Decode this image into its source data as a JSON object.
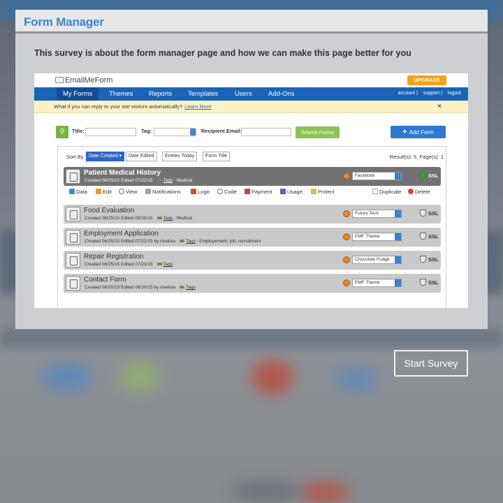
{
  "modal": {
    "title": "Form Manager",
    "description": "This survey is about the form manager page and how we can make this page better for you"
  },
  "start_survey_label": "Start Survey",
  "app": {
    "logo": "EmailMeForm",
    "upgrade": "UPGRADE",
    "nav": [
      "My Forms",
      "Themes",
      "Reports",
      "Templates",
      "Users",
      "Add-Ons"
    ],
    "nav_right": [
      "account",
      "support",
      "logout"
    ],
    "notice_text": "What if you can reply to your site visitors automatically?",
    "notice_link": "Learn More",
    "close": "×",
    "search": {
      "title_label": "Title:",
      "tag_label": "Tag:",
      "recipient_label": "Recipient Email:",
      "button": "Search Forms"
    },
    "add_form": "Add Form",
    "sort_label": "Sort By",
    "sort_options": [
      "Date Created",
      "Date Edited",
      "Entries Today",
      "Form Title"
    ],
    "result": "Result(s): 5, Page(s): 1",
    "actions": [
      "Data",
      "Edit",
      "View",
      "Notifications",
      "Logic",
      "Code",
      "Payment",
      "Usage",
      "Protect",
      "Duplicate",
      "Delete"
    ],
    "forms": [
      {
        "title": "Patient Medical History",
        "meta": "Created 06/25/15   Edited 07/22/15",
        "tags_label": "Tags",
        "tags": ": Medical",
        "theme": "Facebook",
        "ssl": "SSL"
      },
      {
        "title": "Food Evaluation",
        "meta": "Created 06/25/15   Edited 06/25/15",
        "tags_label": "Tags",
        "tags": ": Medical",
        "theme": "Future Tech",
        "ssl": "SSL"
      },
      {
        "title": "Employment Application",
        "meta": "Created 06/25/15   Edited 07/22/15 by niveluia",
        "tags_label": "Tags",
        "tags": ": Employement, job, recruitment",
        "theme": "EMF Theme",
        "ssl": "SSL"
      },
      {
        "title": "Repair Registration",
        "meta": "Created 06/25/15   Edited 07/23/15",
        "tags_label": "Tags",
        "tags": "",
        "theme": "Chocolate Fudge",
        "ssl": "SSL"
      },
      {
        "title": "Contact Form",
        "meta": "Created 06/20/15   Edited 06/20/15 by niveluia",
        "tags_label": "Tags",
        "tags": "",
        "theme": "EMF Theme",
        "ssl": "SSL"
      }
    ]
  },
  "colors": {
    "accent": "#3a86c8",
    "nav": "#1b64b7",
    "upgrade": "#f4a11e",
    "search_button": "#8dc254",
    "add_form": "#2d7ad0"
  }
}
